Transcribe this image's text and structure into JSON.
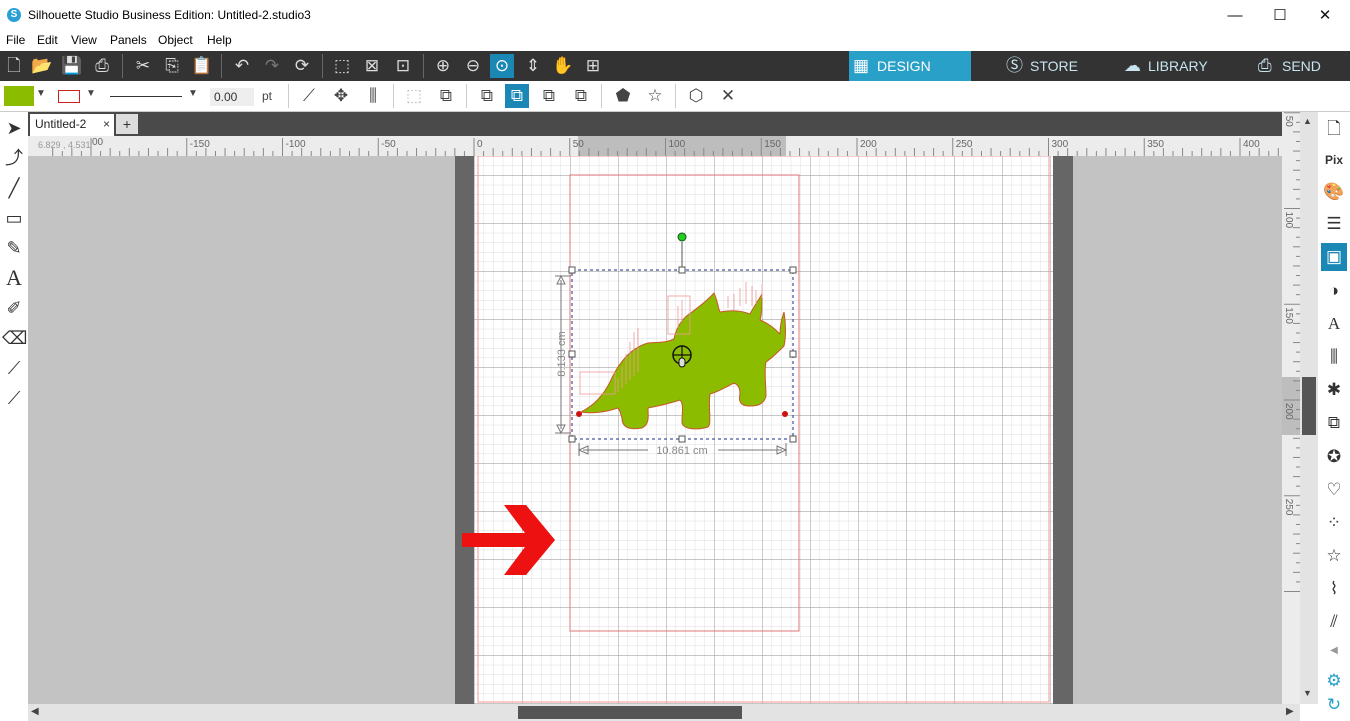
{
  "window": {
    "title": "Silhouette Studio Business Edition: Untitled-2.studio3",
    "app_icon": "S",
    "minimize": "—",
    "maximize": "☐",
    "close": "✕"
  },
  "menu": [
    "File",
    "Edit",
    "View",
    "Panels",
    "Object",
    "Help"
  ],
  "nav_tabs": [
    {
      "label": "DESIGN",
      "icon": "grid-icon",
      "active": true
    },
    {
      "label": "STORE",
      "icon": "silhouette-s-icon",
      "active": false
    },
    {
      "label": "LIBRARY",
      "icon": "cloud-icon",
      "active": false
    },
    {
      "label": "SEND",
      "icon": "cutter-icon",
      "active": false
    }
  ],
  "toolbar2": {
    "fill_color": "#8cbc00",
    "line_color": "#cc2222",
    "line_width": "0.00",
    "line_unit": "pt"
  },
  "document_tab": {
    "label": "Untitled-2",
    "close": "×",
    "add": "+"
  },
  "cursor_readout": "6.829 , 4.531",
  "hruler_labels": [
    "-150",
    "-100",
    "-50",
    "0",
    "50",
    "100",
    "150",
    "200",
    "250",
    "300",
    "350",
    "400"
  ],
  "vruler_labels": [
    "50",
    "100",
    "150",
    "200",
    "250"
  ],
  "hruler_first_partial": "00",
  "selection": {
    "height_label": "8.133 cm",
    "width_label": "10.861 cm"
  },
  "colors": {
    "accent": "#29a0c8",
    "toolbar_dark": "#333333",
    "shape_fill": "#8cbc00",
    "arrow": "#ee1111"
  }
}
